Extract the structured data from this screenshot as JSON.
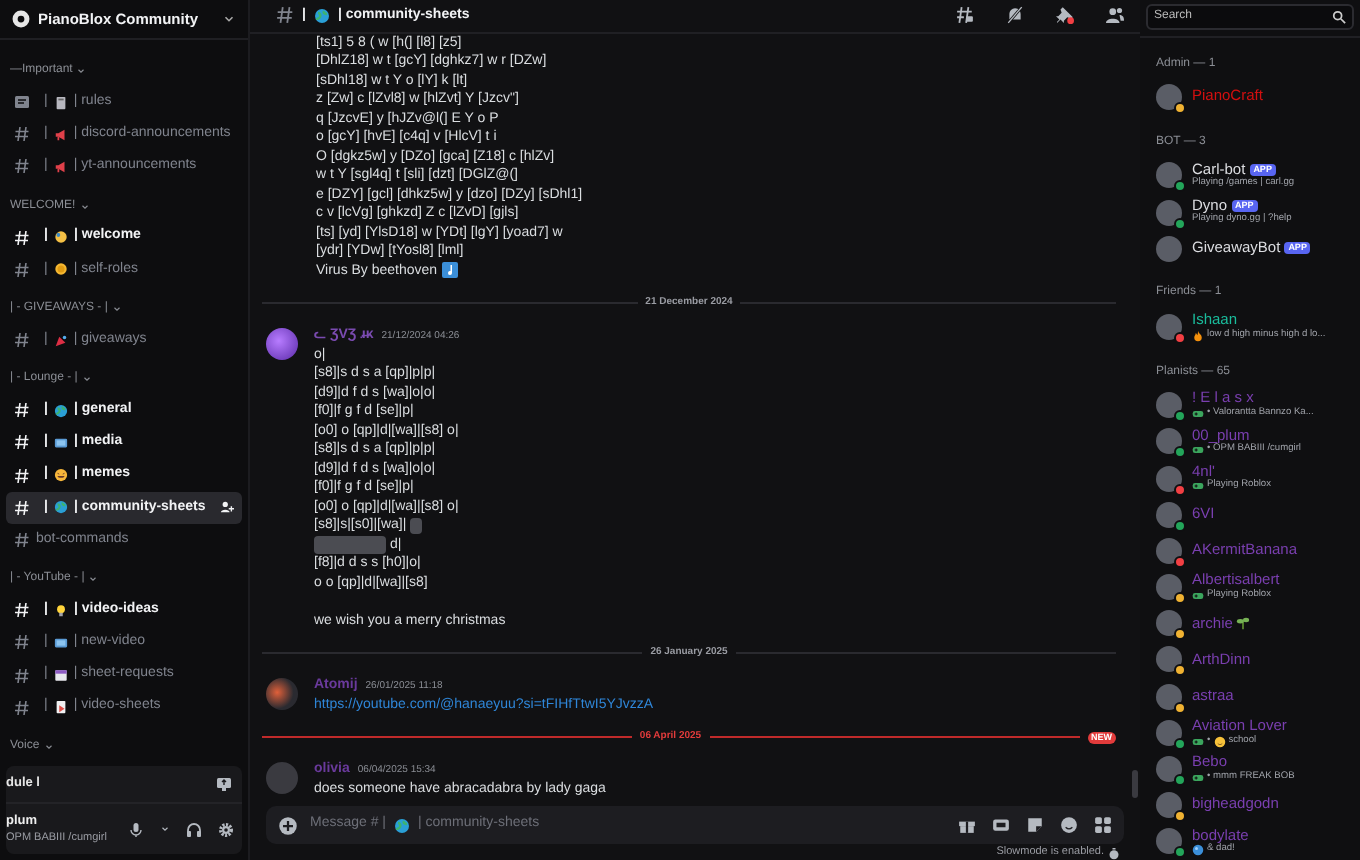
{
  "server": {
    "name": "PianoBlox Community"
  },
  "categories": [
    {
      "name": "—Important",
      "channels": [
        {
          "kind": "rules",
          "lead": "|",
          "label": "| rules",
          "unread": false,
          "selected": false
        },
        {
          "kind": "text",
          "lead": "|",
          "label": "| discord-announcements",
          "unread": false,
          "selected": false
        },
        {
          "kind": "text",
          "lead": "|",
          "label": "| yt-announcements",
          "unread": false,
          "selected": false
        }
      ]
    },
    {
      "name": "WELCOME!",
      "channels": [
        {
          "kind": "text",
          "lead": "|",
          "label": "| welcome",
          "unread": true,
          "selected": false
        },
        {
          "kind": "text",
          "lead": "|",
          "label": "| self-roles",
          "unread": false,
          "selected": false
        }
      ]
    },
    {
      "name": "| - GIVEAWAYS - |",
      "channels": [
        {
          "kind": "text",
          "lead": "|",
          "label": "| giveaways",
          "unread": false,
          "selected": false
        }
      ]
    },
    {
      "name": "| - Lounge - |",
      "channels": [
        {
          "kind": "text",
          "lead": "|",
          "label": "| general",
          "unread": true,
          "selected": false
        },
        {
          "kind": "text",
          "lead": "|",
          "label": "| media",
          "unread": true,
          "selected": false
        },
        {
          "kind": "text",
          "lead": "|",
          "label": "| memes",
          "unread": true,
          "selected": false
        },
        {
          "kind": "text",
          "lead": "|",
          "label": "| community-sheets",
          "unread": true,
          "selected": true
        },
        {
          "kind": "text",
          "label": "bot-commands",
          "unread": false,
          "selected": false
        }
      ]
    },
    {
      "name": "| - YouTube - |",
      "channels": [
        {
          "kind": "text",
          "lead": "|",
          "label": "| video-ideas",
          "unread": true,
          "selected": false
        },
        {
          "kind": "text",
          "lead": "|",
          "label": "| new-video",
          "unread": false,
          "selected": false
        },
        {
          "kind": "text",
          "lead": "|",
          "label": "| sheet-requests",
          "unread": false,
          "selected": false
        },
        {
          "kind": "text",
          "lead": "|",
          "label": "| video-sheets",
          "unread": false,
          "selected": false
        }
      ]
    },
    {
      "name": "Voice"
    }
  ],
  "voice_panel": {
    "label": "dule l"
  },
  "user_panel": {
    "name": "plum",
    "status": "OPM BABIII /cumgirl"
  },
  "channel_header": {
    "lead": "|",
    "name": "| community-sheets"
  },
  "search": {
    "placeholder": "Search"
  },
  "messages": [
    {
      "kind": "continuation",
      "lines": [
        {
          "segments": [
            {
              "kind": "text",
              "text": "[ts1] 5 8 ( w [h(] [l8] [z5]"
            }
          ]
        },
        {
          "segments": [
            {
              "kind": "text",
              "text": "[DhlZ18] w t [gcY] [dghkz7] w r [DZw]"
            }
          ]
        },
        {
          "segments": [
            {
              "kind": "text",
              "text": "[sDhl18] w t Y o [lY] k [lt]"
            }
          ]
        },
        {
          "segments": [
            {
              "kind": "text",
              "text": "z [Zw] c [lZvl8] w [hlZvt] Y [Jzcv\"]"
            }
          ]
        },
        {
          "segments": [
            {
              "kind": "text",
              "text": "q [JzcvE] y [hJZv@l(] E Y o P"
            }
          ]
        },
        {
          "segments": [
            {
              "kind": "text",
              "text": "o [gcY] [hvE] [c4q] v [HlcV] t i"
            }
          ]
        },
        {
          "segments": [
            {
              "kind": "text",
              "text": "O [dgkz5w] y [DZo] [gca] [Z18] c [hlZv]"
            }
          ]
        },
        {
          "segments": [
            {
              "kind": "text",
              "text": "w t Y [sgl4q] t [sli] [dzt] [DGlZ@(]"
            }
          ]
        },
        {
          "segments": [
            {
              "kind": "text",
              "text": "e [DZY] [gcl] [dhkz5w] y [dzo] [DZy] [sDhl1]"
            }
          ]
        },
        {
          "segments": [
            {
              "kind": "text",
              "text": "c v [lcVg] [ghkzd] Z c [lZvD] [gjls]"
            }
          ]
        },
        {
          "segments": [
            {
              "kind": "text",
              "text": "[ts] [yd] [YlsD18] w [YDt] [lgY] [yoad7] w"
            }
          ]
        },
        {
          "segments": [
            {
              "kind": "text",
              "text": "[ydr] [YDw] [tYosl8] [lml]"
            }
          ]
        },
        {
          "segments": [
            {
              "kind": "text",
              "text": "Virus By beethoven"
            },
            {
              "kind": "note"
            }
          ]
        }
      ]
    },
    {
      "kind": "divider",
      "date": "21 December 2024",
      "new": false
    },
    {
      "kind": "message",
      "author": "ᓚ ƷVƷ ɹ̶ᴋ",
      "color": "#7a4bb0",
      "time": "21/12/2024 04:26",
      "lines": [
        {
          "segments": [
            {
              "kind": "text",
              "text": "o|"
            }
          ]
        },
        {
          "segments": [
            {
              "kind": "text",
              "text": "[s8]|s d s a [qp]|p|p|"
            }
          ]
        },
        {
          "segments": [
            {
              "kind": "text",
              "text": "[d9]|d f d s [wa]|o|o|"
            }
          ]
        },
        {
          "segments": [
            {
              "kind": "text",
              "text": "[f0]|f g f d [se]|p|"
            }
          ]
        },
        {
          "segments": [
            {
              "kind": "text",
              "text": "[o0] o [qp]|d|[wa]|[s8] o|"
            }
          ]
        },
        {
          "segments": [
            {
              "kind": "text",
              "text": "[s8]|s d s a [qp]|p|p|"
            }
          ]
        },
        {
          "segments": [
            {
              "kind": "text",
              "text": "[d9]|d f d s [wa]|o|o|"
            }
          ]
        },
        {
          "segments": [
            {
              "kind": "text",
              "text": "[f0]|f g f d [se]|p|"
            }
          ]
        },
        {
          "segments": [
            {
              "kind": "text",
              "text": "[o0] o [qp]|d|[wa]|[s8] o|"
            }
          ]
        },
        {
          "segments": [
            {
              "kind": "text",
              "text": "[s8]|s|[s0]|[wa]|"
            },
            {
              "kind": "spoiler"
            }
          ]
        },
        {
          "segments": [
            {
              "kind": "spoiler"
            },
            {
              "kind": "text",
              "text": "d|"
            }
          ]
        },
        {
          "segments": [
            {
              "kind": "text",
              "text": "[f8]|d d s s [h0]|o|"
            }
          ]
        },
        {
          "segments": [
            {
              "kind": "text",
              "text": "o o [qp]|d|[wa]|[s8]"
            }
          ]
        },
        {
          "gap_before": true,
          "segments": [
            {
              "kind": "text",
              "text": "we wish you a merry christmas"
            }
          ]
        }
      ]
    },
    {
      "kind": "divider",
      "date": "26 January 2025",
      "new": false
    },
    {
      "kind": "message",
      "author": "Atomij",
      "color": "#6a3a9c",
      "time": "26/01/2025 11:18",
      "lines": [
        {
          "segments": [
            {
              "kind": "link",
              "text": "https://youtube.com/@hanaeyuu?si=tFIHfTtwI5YJvzzA"
            }
          ]
        }
      ]
    },
    {
      "kind": "divider",
      "date": "06 April 2025",
      "new": true,
      "badge": "NEW"
    },
    {
      "kind": "message",
      "author": "olivia",
      "color": "#6a3a9c",
      "time": "06/04/2025 15:34",
      "lines": [
        {
          "segments": [
            {
              "kind": "text",
              "text": "does someone have abracadabra by lady gaga"
            }
          ]
        }
      ]
    }
  ],
  "composer": {
    "placeholder_start": "Message # |",
    "placeholder_end": "| community-sheets"
  },
  "slowmode": "Slowmode is enabled.",
  "member_groups": [
    {
      "title": "Admin — 1",
      "members": [
        {
          "name": "PianoCraft",
          "color": "#d40f0f",
          "status": {
            "color": "#f0b232"
          }
        }
      ]
    },
    {
      "title": "BOT — 3",
      "members": [
        {
          "name": "Carl-bot",
          "color": "#dcdde1",
          "status": {
            "color": "#23a55a"
          },
          "tag": [
            {
              "kind": "app",
              "text": "APP"
            }
          ],
          "activity": [
            {
              "kind": "text",
              "text": "Playing /games | carl.gg"
            }
          ]
        },
        {
          "name": "Dyno",
          "color": "#dcdde1",
          "status": {
            "color": "#23a55a"
          },
          "tag": [
            {
              "kind": "app",
              "text": "APP"
            }
          ],
          "activity": [
            {
              "kind": "text",
              "text": "Playing dyno.gg | ?help"
            }
          ]
        },
        {
          "name": "GiveawayBot",
          "color": "#dcdde1",
          "tag": [
            {
              "kind": "app",
              "text": "APP"
            }
          ]
        }
      ]
    },
    {
      "title": "Friends — 1",
      "members": [
        {
          "name": "Ishaan",
          "color": "#1abc9c",
          "status": {
            "color": "#f23f43"
          },
          "activity": [
            {
              "kind": "fire"
            },
            {
              "kind": "text",
              "text": "low d high minus high d lo..."
            }
          ]
        }
      ]
    },
    {
      "title": "Planists — 65",
      "members": [
        {
          "name": "! E l a s x",
          "color": "#7a3fb0",
          "status": {
            "color": "#23a55a"
          },
          "activity": [
            {
              "kind": "game"
            },
            {
              "kind": "text",
              "text": "• Valorantta Bannzo Ka..."
            }
          ]
        },
        {
          "name": "00_plum",
          "color": "#7a3fb0",
          "status": {
            "color": "#23a55a"
          },
          "activity": [
            {
              "kind": "game"
            },
            {
              "kind": "text",
              "text": "• OPM BABIII /cumgirl"
            }
          ]
        },
        {
          "name": "4nl'",
          "color": "#7a3fb0",
          "status": {
            "color": "#f23f43"
          },
          "activity": [
            {
              "kind": "game"
            },
            {
              "kind": "text",
              "text": "Playing Roblox"
            }
          ]
        },
        {
          "name": "6VI",
          "color": "#7a3fb0",
          "status": {
            "color": "#23a55a"
          }
        },
        {
          "name": "AKermitBanana",
          "color": "#7a3fb0",
          "status": {
            "color": "#f23f43"
          }
        },
        {
          "name": "Albertisalbert",
          "color": "#7a3fb0",
          "status": {
            "color": "#f0b232"
          },
          "activity": [
            {
              "kind": "game"
            },
            {
              "kind": "text",
              "text": "Playing Roblox"
            }
          ]
        },
        {
          "name": "archie",
          "color": "#7a3fb0",
          "status": {
            "color": "#f0b232"
          },
          "tag": [
            {
              "kind": "sprout"
            }
          ]
        },
        {
          "name": "ArthDinn",
          "color": "#7a3fb0",
          "status": {
            "color": "#f0b232"
          }
        },
        {
          "name": "astraa",
          "color": "#7a3fb0",
          "status": {
            "color": "#f0b232"
          }
        },
        {
          "name": "Aviation Lover",
          "color": "#7a3fb0",
          "status": {
            "color": "#23a55a"
          },
          "activity": [
            {
              "kind": "game"
            },
            {
              "kind": "text",
              "text": "•"
            },
            {
              "kind": "smile"
            },
            {
              "kind": "text",
              "text": "school"
            }
          ]
        },
        {
          "name": "Bebo",
          "color": "#7a3fb0",
          "status": {
            "color": "#23a55a"
          },
          "activity": [
            {
              "kind": "game"
            },
            {
              "kind": "text",
              "text": "• mmm FREAK BOB"
            }
          ]
        },
        {
          "name": "bigheadgodn",
          "color": "#7a3fb0",
          "status": {
            "color": "#f0b232"
          }
        },
        {
          "name": "bodylate",
          "color": "#7a3fb0",
          "status": {
            "color": "#23a55a"
          },
          "activity": [
            {
              "kind": "orb"
            },
            {
              "kind": "text",
              "text": "& dad!"
            }
          ]
        }
      ]
    }
  ]
}
